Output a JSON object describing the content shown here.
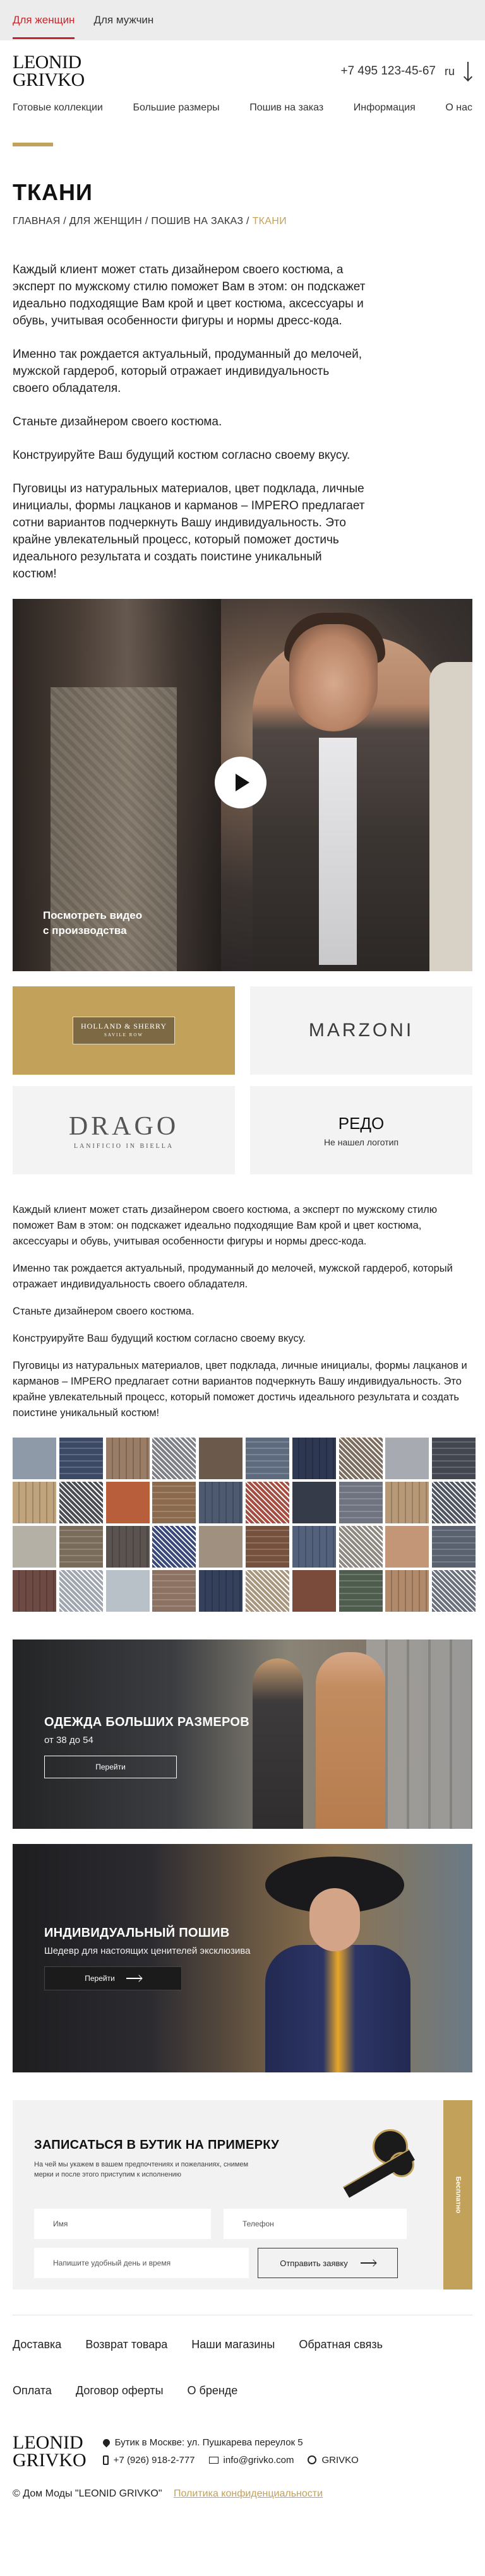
{
  "topbar": {
    "women": "Для женщин",
    "men": "Для мужчин"
  },
  "header": {
    "logo_line1": "LEONID",
    "logo_line2": "GRIVKO",
    "phone": "+7 495 123-45-67",
    "lang": "ru"
  },
  "nav": [
    "Готовые коллекции",
    "Большие размеры",
    "Пошив на заказ",
    "Информация",
    "О нас"
  ],
  "page": {
    "title": "ТКАНИ",
    "breadcrumb": [
      "ГЛАВНАЯ",
      "ДЛЯ ЖЕНЩИН",
      "ПОШИВ НА ЗАКАЗ",
      "ТКАНИ"
    ],
    "breadcrumb_sep": " / "
  },
  "intro": [
    "Каждый клиент может стать дизайнером своего костюма, а эксперт по мужскому стилю поможет Вам в этом: он подскажет идеально подходящие Вам крой и цвет костюма, аксессуары и обувь, учитывая особенности фигуры и нормы дресс-кода.",
    "Именно так рождается актуальный, продуманный до мелочей, мужской гардероб, который отражает индивидуальность своего обладателя.",
    "Станьте дизайнером своего костюма.",
    "Конструируйте Ваш будущий костюм согласно своему вкусу.",
    "Пуговицы из натуральных материалов, цвет подклада, личные инициалы, формы лацканов и карманов – IMPERO предлагает сотни вариантов подчеркнуть Вашу индивидуальность. Это крайне увлекательный процесс, который поможет достичь идеального результата и создать поистине уникальный костюм!"
  ],
  "video": {
    "caption_line1": "Посмотреть видео",
    "caption_line2": "с производства"
  },
  "brands": {
    "holland_line1": "HOLLAND & SHERRY",
    "holland_line2": "SAVILE ROW",
    "marzoni": "MARZONI",
    "drago": "DRAGO",
    "drago_sub": "LANIFICIO IN BIELLA",
    "redo": "РЕДО",
    "redo_note": "Не нашел логотип"
  },
  "description": [
    "Каждый клиент может стать дизайнером своего костюма, а эксперт по мужскому стилю поможет Вам в этом: он подскажет идеально подходящие Вам крой и цвет костюма, аксессуары и обувь, учитывая особенности фигуры и нормы дресс-кода.",
    "Именно так рождается актуальный, продуманный до мелочей, мужской гардероб, который отражает индивидуальность своего обладателя.",
    "Станьте дизайнером своего костюма.",
    "Конструируйте Ваш будущий костюм согласно своему вкусу.",
    "Пуговицы из натуральных материалов, цвет подклада, личные инициалы, формы лацканов и карманов – IMPERO предлагает сотни вариантов подчеркнуть Вашу индивидуальность. Это крайне увлекательный процесс, который поможет достичь идеального результата и создать поистине уникальный костюм!"
  ],
  "swatch_colors": [
    "#8f9aa8",
    "#3c4a66",
    "#9a7d66",
    "#7e8088",
    "#6b5a4b",
    "#5e6a7e",
    "#2f3852",
    "#7d6d5e",
    "#a7aab0",
    "#43474f",
    "#c0a47d",
    "#4b4d55",
    "#b85e3a",
    "#8b6a4e",
    "#4e5a70",
    "#a44f42",
    "#363b4a",
    "#6f7480",
    "#b79978",
    "#505662",
    "#b5b0a6",
    "#7a6c5a",
    "#5a5350",
    "#3a4a7a",
    "#a09080",
    "#76523e",
    "#53617d",
    "#8e8a82",
    "#c39678",
    "#5a6270",
    "#6d4a43",
    "#9fa6b0",
    "#b8c0c8",
    "#8c7262",
    "#35405c",
    "#a8977e",
    "#7a4a3a",
    "#4e5d4e",
    "#b08a6a",
    "#6a707c"
  ],
  "promo1": {
    "title": "ОДЕЖДА БОЛЬШИХ РАЗМЕРОВ",
    "subtitle": "от 38 до 54",
    "button": "Перейти"
  },
  "promo2": {
    "title": "ИНДИВИДУАЛЬНЫЙ ПОШИВ",
    "subtitle": "Шедевр для настоящих ценителей эксклюзива",
    "button": "Перейти"
  },
  "booking": {
    "title": "ЗАПИСАТЬСЯ В БУТИК НА ПРИМЕРКУ",
    "note": "На чей мы укажем в вашем предпочтениях и пожеланиях, снимем мерки и после этого приступим к исполнению",
    "name_placeholder": "Имя",
    "phone_placeholder": "Телефон",
    "date_placeholder": "Напишите удобный день и время",
    "submit": "Отправить заявку",
    "side_tab": "Бесплатно"
  },
  "footer": {
    "links": [
      "Доставка",
      "Возврат товара",
      "Наши магазины",
      "Обратная связь",
      "Оплата",
      "Договор оферты",
      "О бренде"
    ],
    "logo_line1": "LEONID",
    "logo_line2": "GRIVKO",
    "address": "Бутик в Москве: ул. Пушкарева переулок 5",
    "phone": "+7 (926) 918-2-777",
    "email": "info@grivko.com",
    "instagram": "GRIVKO",
    "copyright": "© Дом Моды \"LEONID GRIVKO\"",
    "privacy": "Политика конфиденциальности"
  },
  "colors": {
    "accent_gold": "#c2a15b",
    "active_red": "#c1272d"
  }
}
